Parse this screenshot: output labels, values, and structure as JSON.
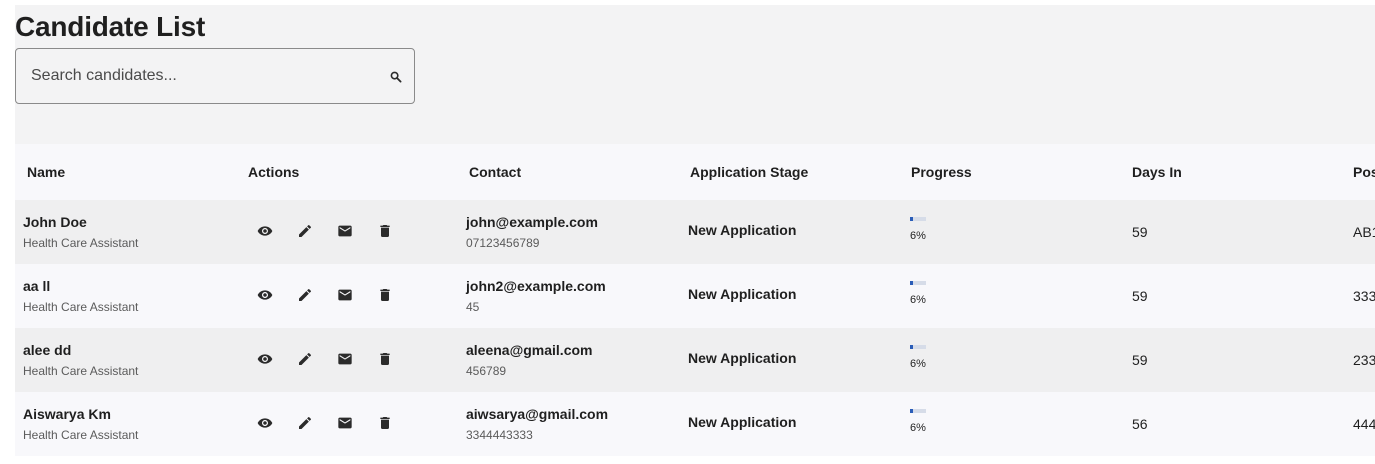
{
  "page": {
    "title": "Candidate List"
  },
  "search": {
    "placeholder": "Search candidates...",
    "icon": "search-icon"
  },
  "table": {
    "columns": [
      "Name",
      "Actions",
      "Contact",
      "Application Stage",
      "Progress",
      "Days In",
      "Pos"
    ],
    "actions": [
      "view-icon",
      "edit-icon",
      "email-icon",
      "delete-icon"
    ],
    "rows": [
      {
        "name": "John Doe",
        "role": "Health Care Assistant",
        "email": "john@example.com",
        "phone": "07123456789",
        "stage": "New Application",
        "progress": "6%",
        "progress_value": 0.06,
        "days": "59",
        "postcode": "AB1"
      },
      {
        "name": "aa ll",
        "role": "Health Care Assistant",
        "email": "john2@example.com",
        "phone": "45",
        "stage": "New Application",
        "progress": "6%",
        "progress_value": 0.06,
        "days": "59",
        "postcode": "333"
      },
      {
        "name": "alee dd",
        "role": "Health Care Assistant",
        "email": "aleena@gmail.com",
        "phone": "456789",
        "stage": "New Application",
        "progress": "6%",
        "progress_value": 0.06,
        "days": "59",
        "postcode": "233"
      },
      {
        "name": "Aiswarya Km",
        "role": "Health Care Assistant",
        "email": "aiwsarya@gmail.com",
        "phone": "3344443333",
        "stage": "New Application",
        "progress": "6%",
        "progress_value": 0.06,
        "days": "56",
        "postcode": "444"
      }
    ]
  },
  "colors": {
    "panel_background": "#f3f3f4",
    "row_odd": "#efeff0",
    "row_even": "#f8f8fb",
    "progress_fill": "#2a5db8",
    "progress_track": "#d6dce8",
    "icon": "#2b2b2b"
  }
}
